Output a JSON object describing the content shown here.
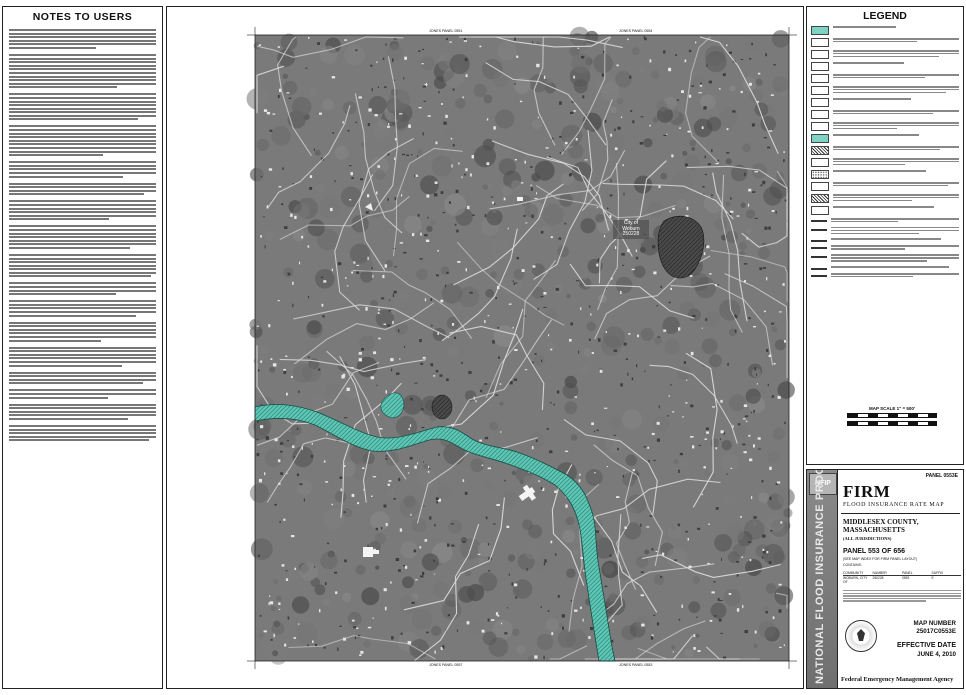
{
  "notes": {
    "title": "NOTES TO USERS",
    "paragraph_line_counts": [
      6,
      10,
      8,
      9,
      5,
      4,
      6,
      7,
      7,
      4,
      5,
      6,
      6,
      4,
      3,
      5,
      5
    ]
  },
  "map": {
    "zone_label": "ZONE X",
    "city_label": "City of Woburn 250228",
    "top_labels": [
      "JONES PANEL 0551",
      "JONES PANEL 0554"
    ],
    "bottom_labels": [
      "JONES PANEL 0557",
      "JONES PANEL 0553"
    ],
    "colors": {
      "flood_zone": "#5ec6b4",
      "imagery_base": "#7a7a7a",
      "frame": "#222222"
    }
  },
  "legend": {
    "title": "LEGEND",
    "scale_text": "MAP SCALE 1\" = 500'"
  },
  "title_block": {
    "panel_top": "PANEL 0553E",
    "firm": "FIRM",
    "firm_subtitle": "FLOOD INSURANCE RATE MAP",
    "county": "MIDDLESEX COUNTY, MASSACHUSETTS",
    "jurisdictions": "(ALL JURISDICTIONS)",
    "panel_of": "PANEL 553 OF 656",
    "index_note": "(SEE MAP INDEX FOR FIRM PANEL LAYOUT)",
    "contains": "CONTAINS:",
    "col_headers": [
      "COMMUNITY",
      "NUMBER",
      "PANEL",
      "SUFFIX"
    ],
    "row": [
      "WOBURN, CITY OF",
      "250228",
      "0553",
      "E"
    ],
    "map_number_label": "MAP NUMBER",
    "map_number": "25017C0553E",
    "effective_label": "EFFECTIVE DATE",
    "effective_date": "JUNE 4, 2010",
    "agency": "Federal Emergency Management Agency",
    "strip_text": "NATIONAL FLOOD INSURANCE PROGRAM",
    "logo_text": "NFIP"
  }
}
